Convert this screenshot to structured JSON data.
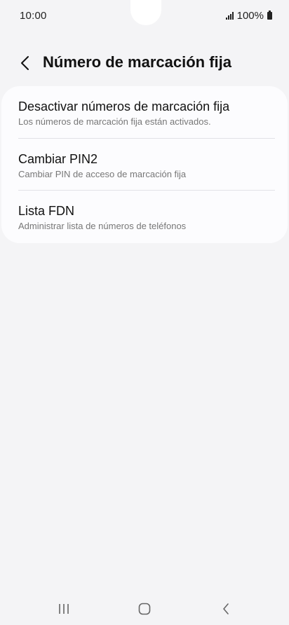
{
  "status_bar": {
    "time": "10:00",
    "battery": "100%",
    "icons": [
      "signal-icon",
      "battery-icon"
    ]
  },
  "header": {
    "title": "Número de marcación fija",
    "back_icon": "chevron-left-icon"
  },
  "settings": {
    "items": [
      {
        "title": "Desactivar números de marcación fija",
        "subtitle": "Los números de marcación fija están activados."
      },
      {
        "title": "Cambiar PIN2",
        "subtitle": "Cambiar PIN de acceso de marcación fija"
      },
      {
        "title": "Lista FDN",
        "subtitle": "Administrar lista de números de teléfonos"
      }
    ]
  },
  "nav_bar": {
    "icons": [
      "recents-icon",
      "home-icon",
      "back-icon"
    ]
  },
  "colors": {
    "background": "#f4f4f6",
    "card": "#fcfcfe",
    "title_text": "#111111",
    "subtitle_text": "#777777",
    "divider": "#e2e2e6"
  }
}
